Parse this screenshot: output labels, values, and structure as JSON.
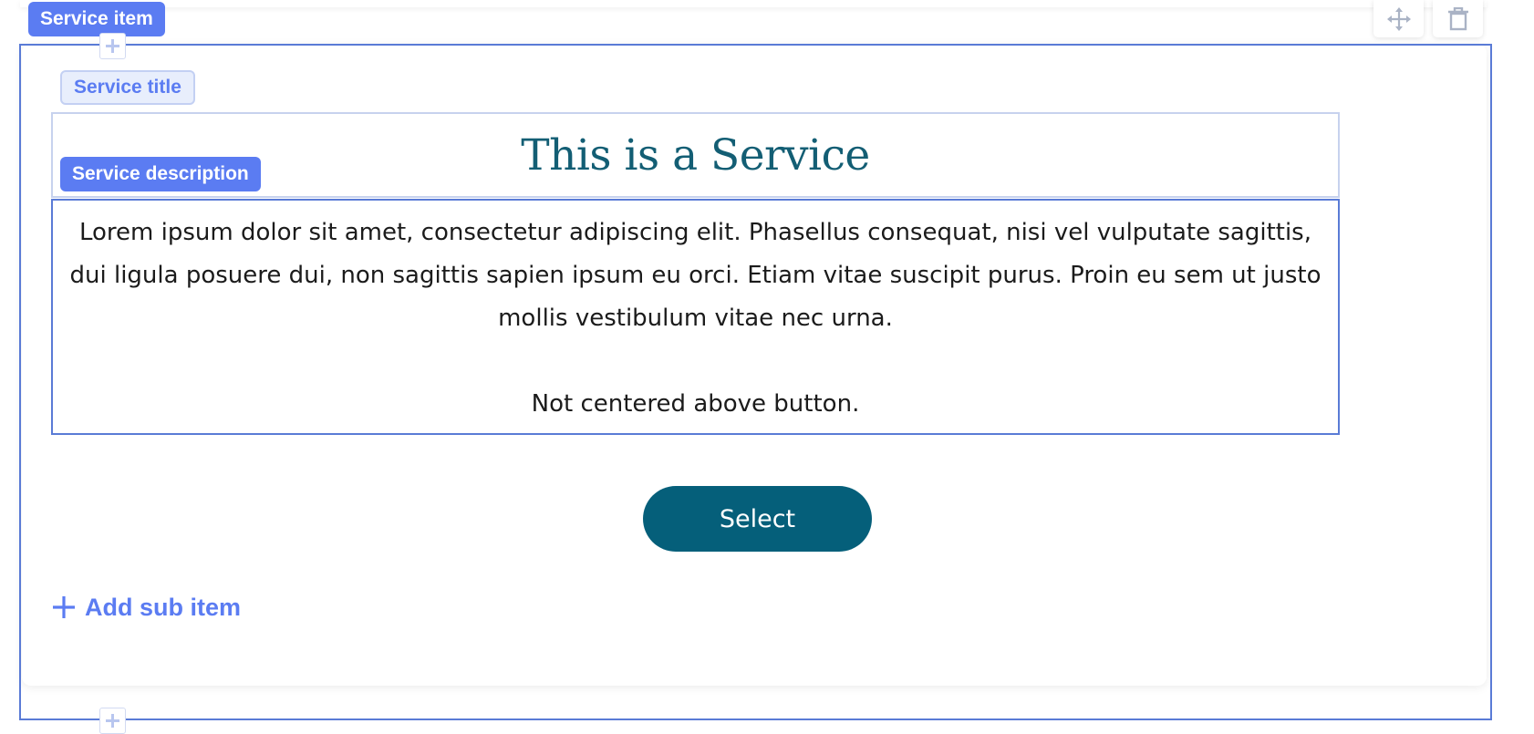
{
  "labels": {
    "service_item": "Service item",
    "service_title": "Service title",
    "service_description": "Service description"
  },
  "service": {
    "title": "This is a Service",
    "description": "Lorem ipsum dolor sit amet, consectetur adipiscing elit. Phasellus consequat, nisi vel vulputate sagittis, dui ligula posuere dui, non sagittis sapien ipsum eu orci. Etiam vitae suscipit purus. Proin eu sem ut justo mollis vestibulum vitae nec urna.",
    "description_note": "Not centered above button.",
    "button_label": "Select"
  },
  "actions": {
    "add_sub_item": "Add sub item"
  },
  "icons": {
    "move": "move-icon",
    "delete": "trash-icon",
    "plus": "plus-icon"
  },
  "colors": {
    "accent": "#5b7cf2",
    "outline": "#5a7bd6",
    "title": "#135e74",
    "button": "#055f7a"
  }
}
